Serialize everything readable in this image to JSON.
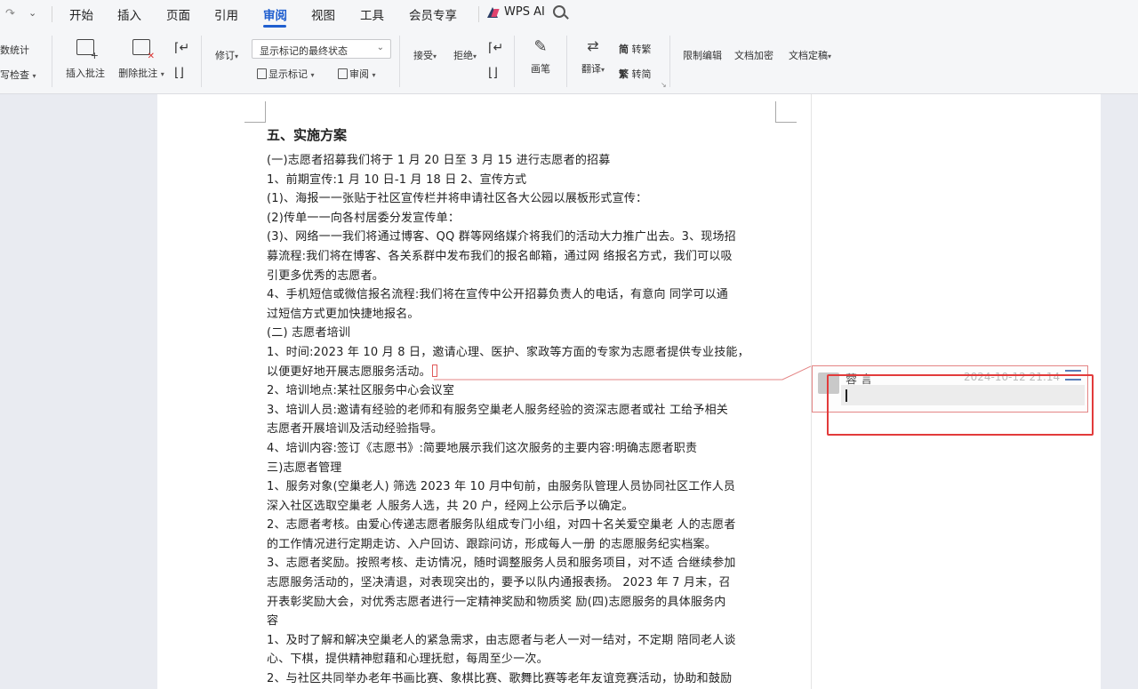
{
  "menubar": {
    "tabs": [
      "开始",
      "插入",
      "页面",
      "引用",
      "审阅",
      "视图",
      "工具",
      "会员专享"
    ],
    "active_tab": "审阅",
    "ai_label": "WPS AI"
  },
  "ribbon": {
    "left_clipped": [
      "数统计",
      "写检查"
    ],
    "insert_comment": "插入批注",
    "delete_comment": "删除批注",
    "track_changes": "修订",
    "markup_state": "显示标记的最终状态",
    "show_markup": "显示标记",
    "review_pane": "审阅",
    "accept": "接受",
    "reject": "拒绝",
    "pen": "画笔",
    "translate": "翻译",
    "to_traditional": "转繁",
    "to_simplified": "转简",
    "restrict_edit": "限制编辑",
    "encrypt": "文档加密",
    "finalize": "文档定稿"
  },
  "document": {
    "heading": "五、实施方案",
    "lines": [
      "(一)志愿者招募我们将于 1 月 20 日至 3 月 15 进行志愿者的招募",
      "1、前期宣传:1 月 10 日-1 月 18 日 2、宣传方式",
      "(1)、海报一一张贴于社区宣传栏并将申请社区各大公园以展板形式宣传：",
      "(2)传单一一向各村居委分发宣传单：",
      "(3)、网络一一我们将通过博客、QQ 群等网络媒介将我们的活动大力推广出去。3、现场招",
      "募流程:我们将在博客、各关系群中发布我们的报名邮箱，通过网 络报名方式，我们可以吸",
      "引更多优秀的志愿者。",
      "4、手机短信或微信报名流程:我们将在宣传中公开招募负责人的电话，有意向 同学可以通",
      "过短信方式更加快捷地报名。",
      "(二) 志愿者培训",
      "1、时间:2023 年 10 月 8 日，邀请心理、医护、家政等方面的专家为志愿者提供专业技能，",
      "以便更好地开展志愿服务活动。",
      "2、培训地点:某社区服务中心会议室",
      "3、培训人员:邀请有经验的老师和有服务空巢老人服务经验的资深志愿者或社 工给予相关",
      "志愿者开展培训及活动经验指导。",
      "4、培训内容:签订《志愿书》:简要地展示我们这次服务的主要内容:明确志愿者职责",
      "三)志愿者管理",
      "1、服务对象(空巢老人) 筛选 2023 年 10 月中旬前，由服务队管理人员协同社区工作人员",
      "深入社区选取空巢老 人服务人选，共 20 户，经网上公示后予以确定。",
      "2、志愿者考核。由爱心传递志愿者服务队组成专门小组，对四十名关爱空巢老 人的志愿者",
      "的工作情况进行定期走访、入户回访、跟踪问访，形成每人一册 的志愿服务纪实档案。",
      "3、志愿者奖励。按照考核、走访情况，随时调整服务人员和服务项目，对不适 合继续参加",
      "志愿服务活动的，坚决清退，对表现突出的，要予以队内通报表扬。 2023 年 7 月末，召",
      "开表彰奖励大会，对优秀志愿者进行一定精神奖励和物质奖 励(四)志愿服务的具体服务内",
      "容",
      "1、及时了解和解决空巢老人的紧急需求，由志愿者与老人一对一结对，不定期 陪同老人谈",
      "心、下棋，提供精神慰藉和心理抚慰，每周至少一次。",
      "2、与社区共同举办老年书画比赛、象棋比赛、歌舞比赛等老年友谊竞赛活动，协助和鼓励"
    ]
  },
  "comment": {
    "author": "蓉 言",
    "time": "2024-10-12 21:14",
    "text": ""
  },
  "colors": {
    "accent": "#1f5ecf",
    "highlight": "#e23b3b",
    "comment_border": "#e48585"
  }
}
